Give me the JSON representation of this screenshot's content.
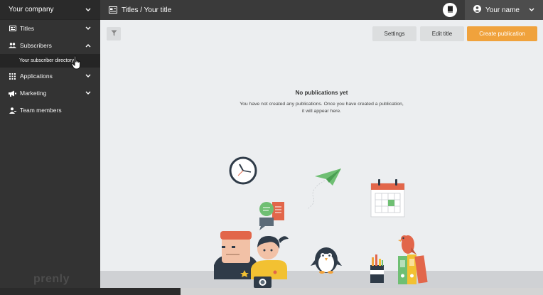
{
  "sidebar": {
    "company": "Your company",
    "items": [
      {
        "label": "Titles",
        "icon": "titles-icon"
      },
      {
        "label": "Subscribers",
        "icon": "subscribers-icon"
      },
      {
        "label": "Applications",
        "icon": "applications-icon"
      },
      {
        "label": "Marketing",
        "icon": "marketing-icon"
      },
      {
        "label": "Team members",
        "icon": "team-members-icon"
      }
    ],
    "sub_items": [
      {
        "label": "Your subscriber directory"
      }
    ],
    "brand": "prenly"
  },
  "header": {
    "breadcrumb": "Titles / Your title",
    "user_name": "Your name"
  },
  "toolbar": {
    "settings_label": "Settings",
    "edit_label": "Edit title",
    "create_label": "Create publication"
  },
  "empty_state": {
    "title": "No publications yet",
    "line1": "You have not created any publications. Once you have created a publication,",
    "line2": "it will appear here."
  },
  "colors": {
    "accent": "#f0a23c",
    "sidebar": "#333333",
    "content_bg": "#eceef0"
  }
}
